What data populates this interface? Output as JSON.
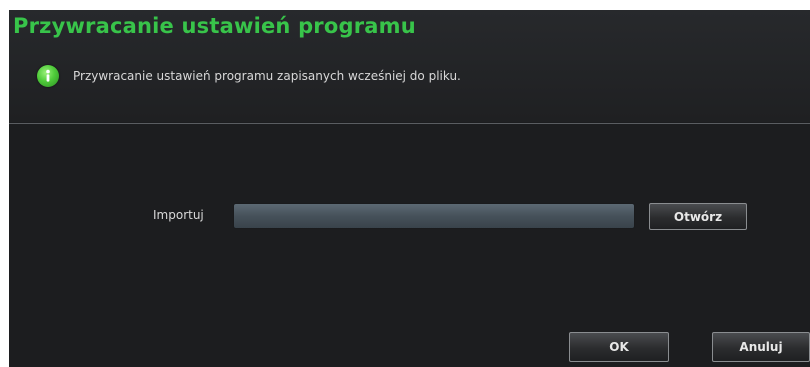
{
  "dialog": {
    "title": "Przywracanie ustawień programu",
    "info_icon": "info-icon",
    "description": "Przywracanie ustawień programu zapisanych wcześniej do pliku.",
    "import": {
      "label": "Importuj",
      "value": "",
      "open_button": "Otwórz"
    },
    "buttons": {
      "ok": "OK",
      "cancel": "Anuluj"
    }
  },
  "colors": {
    "title": "#38c44a",
    "background": "#1c1d1f",
    "text": "#d8d8d8"
  }
}
